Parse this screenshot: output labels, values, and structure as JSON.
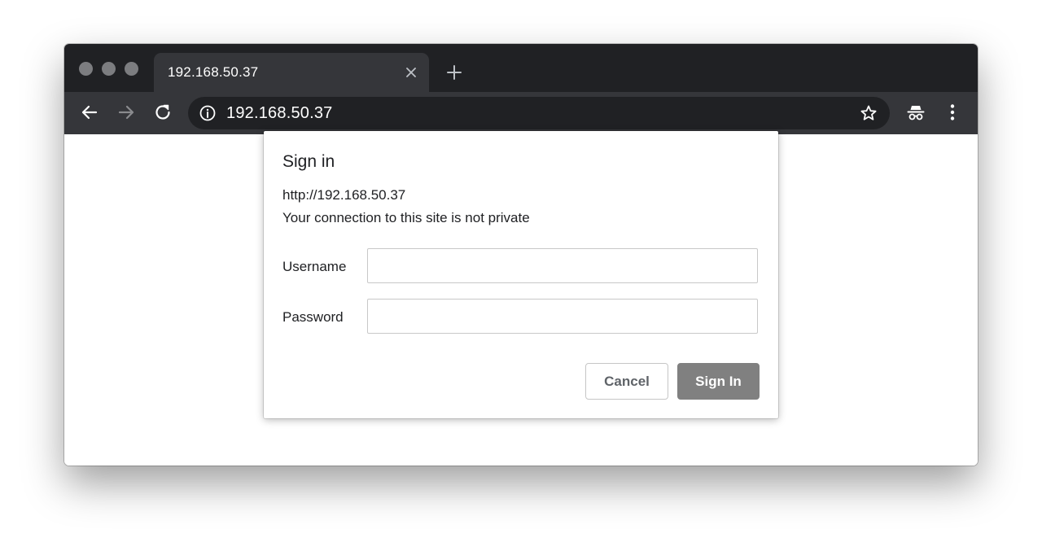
{
  "browser": {
    "tab": {
      "title": "192.168.50.37"
    },
    "address_bar": {
      "url": "192.168.50.37"
    },
    "icons": {
      "close_tab": "close-icon",
      "new_tab": "plus-icon",
      "back": "arrow-left-icon",
      "forward": "arrow-right-icon",
      "reload": "reload-icon",
      "site_info": "info-icon",
      "bookmark": "star-icon",
      "incognito": "incognito-icon",
      "menu": "more-vert-icon"
    },
    "colors": {
      "tabstrip": "#202124",
      "toolbar": "#35363a",
      "omnibox": "#202124"
    }
  },
  "dialog": {
    "title": "Sign in",
    "origin": "http://192.168.50.37",
    "warning": "Your connection to this site is not private",
    "username_label": "Username",
    "username_value": "",
    "password_label": "Password",
    "password_value": "",
    "cancel_label": "Cancel",
    "signin_label": "Sign In",
    "colors": {
      "signin_button": "#808080"
    }
  }
}
